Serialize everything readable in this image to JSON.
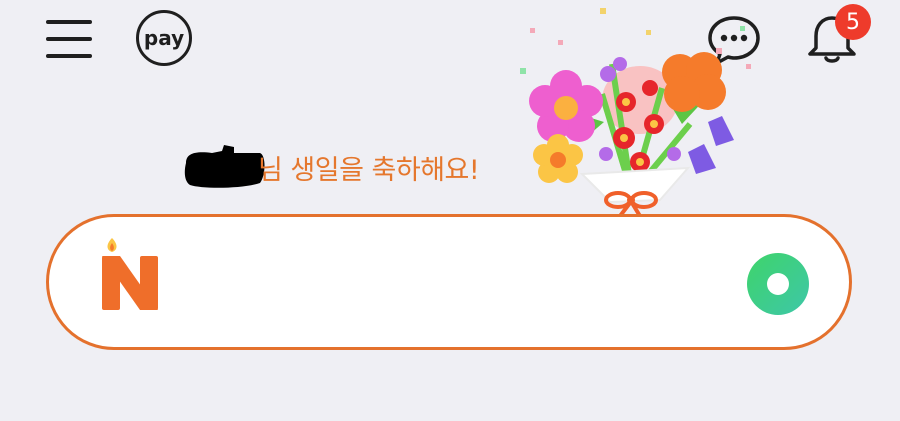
{
  "header": {
    "menu_icon": "hamburger-menu-icon",
    "pay_label": "pay",
    "chat_icon": "chat-bubble-icon",
    "bell_icon": "bell-icon",
    "notification_count": "5"
  },
  "greeting": {
    "text": "님 생일을 축하해요!"
  },
  "search": {
    "logo_letter": "N",
    "logo_icon": "birthday-candle-n-logo-icon",
    "action_icon": "green-circle-button-icon"
  },
  "colors": {
    "background": "#efeff4",
    "accent": "#e4712d",
    "badge": "#ee3b2b",
    "green": "#3ed47a"
  }
}
